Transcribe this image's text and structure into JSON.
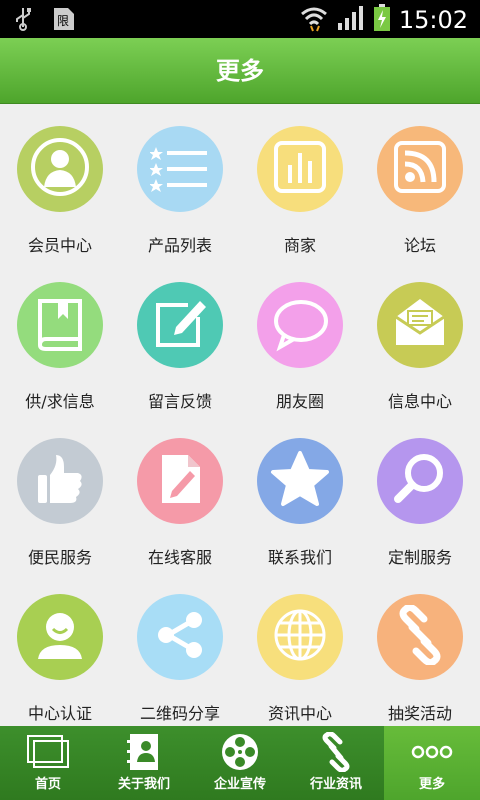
{
  "status_bar": {
    "time": "15:02"
  },
  "header": {
    "title": "更多"
  },
  "grid": [
    {
      "label": "会员中心",
      "icon": "member-icon",
      "color": "#b7cf62"
    },
    {
      "label": "产品列表",
      "icon": "list-icon",
      "color": "#a8d9f3"
    },
    {
      "label": "商家",
      "icon": "bar-chart-icon",
      "color": "#f7de7c"
    },
    {
      "label": "论坛",
      "icon": "rss-icon",
      "color": "#f7b87a"
    },
    {
      "label": "供/求信息",
      "icon": "book-icon",
      "color": "#94dc7d"
    },
    {
      "label": "留言反馈",
      "icon": "edit-icon",
      "color": "#4fc9b4"
    },
    {
      "label": "朋友圈",
      "icon": "speech-bubble-icon",
      "color": "#f3a0ea"
    },
    {
      "label": "信息中心",
      "icon": "mail-icon",
      "color": "#c7cb55"
    },
    {
      "label": "便民服务",
      "icon": "thumbs-up-icon",
      "color": "#c3cbd3"
    },
    {
      "label": "在线客服",
      "icon": "document-edit-icon",
      "color": "#f59aa8"
    },
    {
      "label": "联系我们",
      "icon": "star-icon",
      "color": "#84a8e6"
    },
    {
      "label": "定制服务",
      "icon": "magnifier-icon",
      "color": "#b596ee"
    },
    {
      "label": "中心认证",
      "icon": "smiley-user-icon",
      "color": "#a8cf52"
    },
    {
      "label": "二维码分享",
      "icon": "share-icon",
      "color": "#a8ddf6"
    },
    {
      "label": "资讯中心",
      "icon": "globe-icon",
      "color": "#f7df7c"
    },
    {
      "label": "抽奖活动",
      "icon": "link-icon",
      "color": "#f7b27c"
    }
  ],
  "bottom_nav": [
    {
      "label": "首页",
      "icon": "home-icon"
    },
    {
      "label": "关于我们",
      "icon": "contacts-icon"
    },
    {
      "label": "企业宣传",
      "icon": "film-reel-icon"
    },
    {
      "label": "行业资讯",
      "icon": "link-icon"
    },
    {
      "label": "更多",
      "icon": "more-icon"
    }
  ],
  "colors": {
    "header": "#5cb535",
    "nav": "#3a8a28",
    "nav_active": "#5eb236"
  }
}
